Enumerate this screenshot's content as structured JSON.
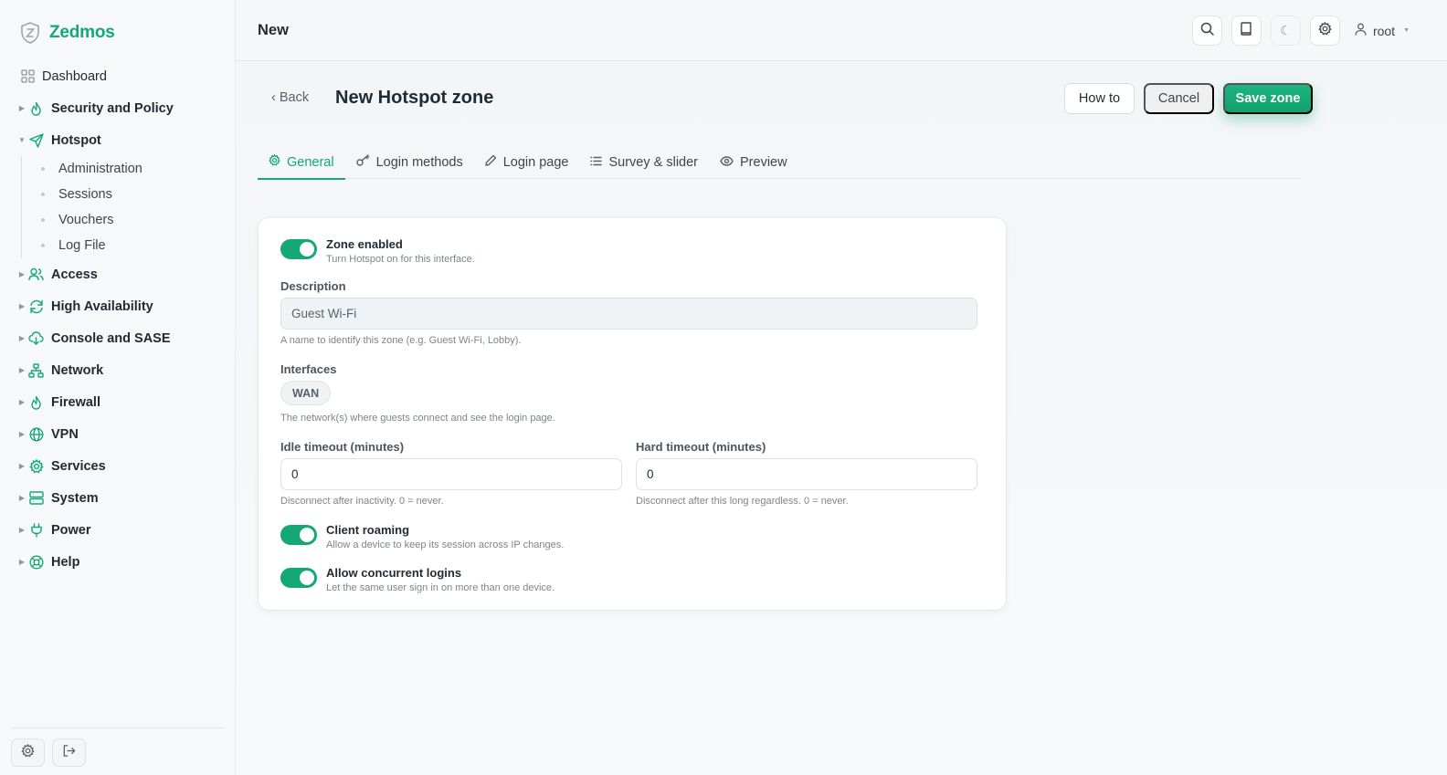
{
  "brand": {
    "name": "Zedmos"
  },
  "sidebar": {
    "dashboard": "Dashboard",
    "items": [
      {
        "label": "Security and Policy",
        "icon": "flame-icon"
      },
      {
        "label": "Hotspot",
        "icon": "send-icon",
        "expanded": true
      },
      {
        "label": "Access",
        "icon": "users-icon"
      },
      {
        "label": "High Availability",
        "icon": "refresh-icon"
      },
      {
        "label": "Console and SASE",
        "icon": "cloud-download-icon"
      },
      {
        "label": "Network",
        "icon": "network-icon"
      },
      {
        "label": "Firewall",
        "icon": "flame-icon"
      },
      {
        "label": "VPN",
        "icon": "globe-icon"
      },
      {
        "label": "Services",
        "icon": "gear-icon"
      },
      {
        "label": "System",
        "icon": "server-icon"
      },
      {
        "label": "Power",
        "icon": "plug-icon"
      },
      {
        "label": "Help",
        "icon": "lifebuoy-icon"
      }
    ],
    "hotspot_sub": [
      "Administration",
      "Sessions",
      "Vouchers",
      "Log File"
    ]
  },
  "topbar": {
    "title": "New",
    "user": "root"
  },
  "page": {
    "back": "Back",
    "title": "New Hotspot zone",
    "actions": {
      "how_to": "How to",
      "cancel": "Cancel",
      "save": "Save zone"
    },
    "tabs": [
      "General",
      "Login methods",
      "Login page",
      "Survey & slider",
      "Preview"
    ],
    "active_tab": "General"
  },
  "form": {
    "zone_enabled": {
      "label": "Zone enabled",
      "help": "Turn Hotspot on for this interface.",
      "on": true
    },
    "description": {
      "label": "Description",
      "value": "Guest Wi-Fi",
      "help": "A name to identify this zone (e.g. Guest Wi-Fi, Lobby)."
    },
    "interfaces": {
      "label": "Interfaces",
      "chip": "WAN",
      "help": "The network(s) where guests connect and see the login page."
    },
    "idle_timeout": {
      "label": "Idle timeout (minutes)",
      "value": "0",
      "help": "Disconnect after inactivity. 0 = never."
    },
    "hard_timeout": {
      "label": "Hard timeout (minutes)",
      "value": "0",
      "help": "Disconnect after this long regardless. 0 = never."
    },
    "client_roaming": {
      "label": "Client roaming",
      "help": "Allow a device to keep its session across IP changes.",
      "on": true
    },
    "concurrent": {
      "label": "Allow concurrent logins",
      "help": "Let the same user sign in on more than one device.",
      "on": true
    }
  },
  "colors": {
    "accent": "#13a874",
    "text": "#1f2a33",
    "muted": "#7a8690"
  }
}
